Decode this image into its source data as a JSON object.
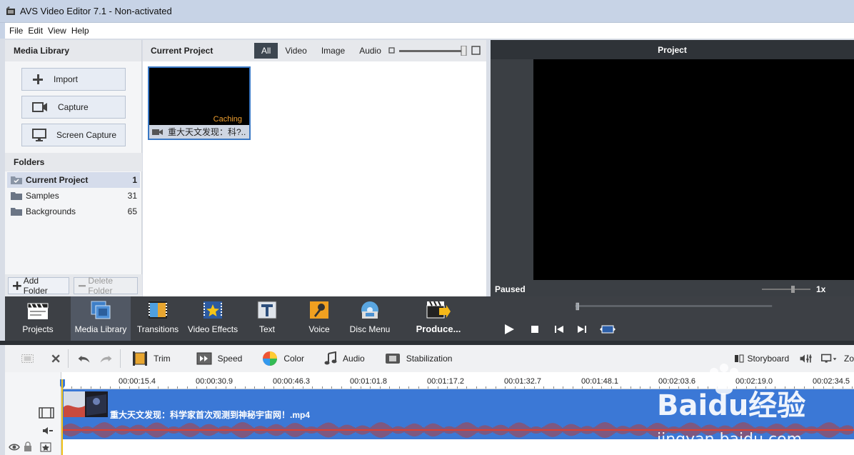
{
  "window": {
    "title": "AVS Video Editor 7.1 - Non-activated"
  },
  "menu": [
    "File",
    "Edit",
    "View",
    "Help"
  ],
  "media_library": {
    "title": "Media Library",
    "buttons": {
      "import": "Import",
      "capture": "Capture",
      "screen_capture": "Screen Capture"
    },
    "folders_title": "Folders",
    "folders": [
      {
        "name": "Current Project",
        "count": "1",
        "selected": true
      },
      {
        "name": "Samples",
        "count": "31",
        "selected": false
      },
      {
        "name": "Backgrounds",
        "count": "65",
        "selected": false
      }
    ],
    "add_folder": "Add Folder",
    "delete_folder": "Delete Folder"
  },
  "current_project": {
    "title": "Current Project",
    "filters": [
      "All",
      "Video",
      "Image",
      "Audio"
    ],
    "active_filter": "All",
    "item": {
      "status": "Caching",
      "label": "重大天文发现：科?.."
    }
  },
  "preview": {
    "title": "Project",
    "status": "Paused",
    "speed": "1x"
  },
  "modes": {
    "projects": "Projects",
    "media_library": "Media Library",
    "transitions": "Transitions",
    "video_effects": "Video Effects",
    "text": "Text",
    "voice": "Voice",
    "disc_menu": "Disc Menu",
    "produce": "Produce..."
  },
  "timeline_tools": {
    "trim": "Trim",
    "speed": "Speed",
    "color": "Color",
    "audio": "Audio",
    "stabilization": "Stabilization",
    "storyboard": "Storyboard",
    "zoom": "Zo"
  },
  "ruler": [
    "00:00:15.4",
    "00:00:30.9",
    "00:00:46.3",
    "00:01:01.8",
    "00:01:17.2",
    "00:01:32.7",
    "00:01:48.1",
    "00:02:03.6",
    "00:02:19.0",
    "00:02:34.5"
  ],
  "clip": {
    "name": "重大天文发现：科学家首次观测到神秘宇宙网！.mp4"
  },
  "watermark": {
    "brand": "Baidu经验",
    "url": "jingyan.baidu.com"
  },
  "colors": {
    "accent_blue": "#3b78d6",
    "dark_toolbar": "#3d4045",
    "caching_orange": "#f0a030"
  }
}
